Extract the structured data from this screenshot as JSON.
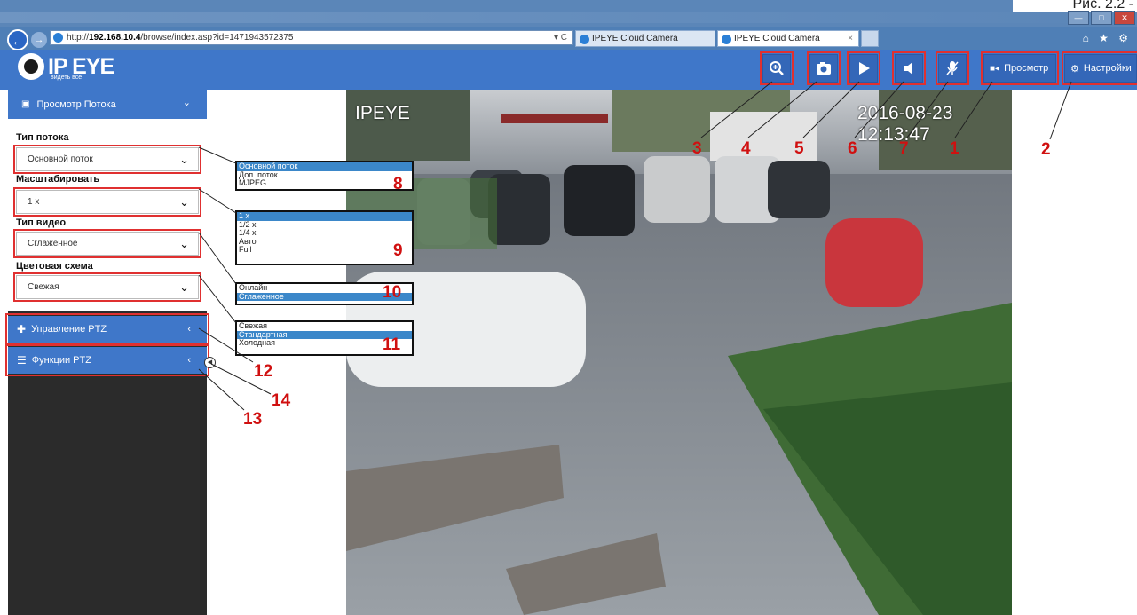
{
  "caption": "Рис. 2.2 -",
  "browser": {
    "url_prefix": "http://",
    "url_host": "192.168.10.4",
    "url_path": "/browse/index.asp?id=1471943572375",
    "reload_glyph": "▾ C",
    "tabs": [
      {
        "label": "IPEYE Cloud Camera"
      },
      {
        "label": "IPEYE Cloud Camera",
        "close": "×"
      }
    ],
    "tools_glyphs": "⌂ ★ ⚙"
  },
  "logo": {
    "text": "IP EYE",
    "subtitle": "видеть все"
  },
  "toolbar": {
    "view_label": "Просмотр",
    "settings_label": "Настройки"
  },
  "sidebar": {
    "stream_header": "Просмотр Потока",
    "fields": [
      {
        "label": "Тип потока",
        "value": "Основной поток"
      },
      {
        "label": "Масштабировать",
        "value": "1 x"
      },
      {
        "label": "Тип видео",
        "value": "Сглаженное"
      },
      {
        "label": "Цветовая схема",
        "value": "Свежая"
      }
    ],
    "ptz_control": "Управление PTZ",
    "ptz_functions": "Функции PTZ",
    "chevron": "‹",
    "chevron_down": "⌄"
  },
  "video": {
    "brand": "IPEYE",
    "timestamp": "2016-08-23 12:13:47"
  },
  "popups": {
    "stream_type": {
      "options": [
        "Основной поток",
        "Доп. поток",
        "MJPEG"
      ],
      "selected": 0
    },
    "scale": {
      "options": [
        "1 x",
        "1/2 x",
        "1/4 x",
        "Авто",
        "Full"
      ],
      "selected": 0
    },
    "video_type": {
      "options": [
        "Онлайн",
        "Сглаженное"
      ],
      "selected": 1
    },
    "color_scheme": {
      "options": [
        "Свежая",
        "Стандартная",
        "Холодная"
      ],
      "selected": 1
    }
  },
  "callouts": [
    "1",
    "2",
    "3",
    "4",
    "5",
    "6",
    "7",
    "8",
    "9",
    "10",
    "11",
    "12",
    "13",
    "14"
  ],
  "colors": {
    "accent": "#3f77c9",
    "callout": "#d01010",
    "sidebar_dark": "#2b2b2b"
  }
}
